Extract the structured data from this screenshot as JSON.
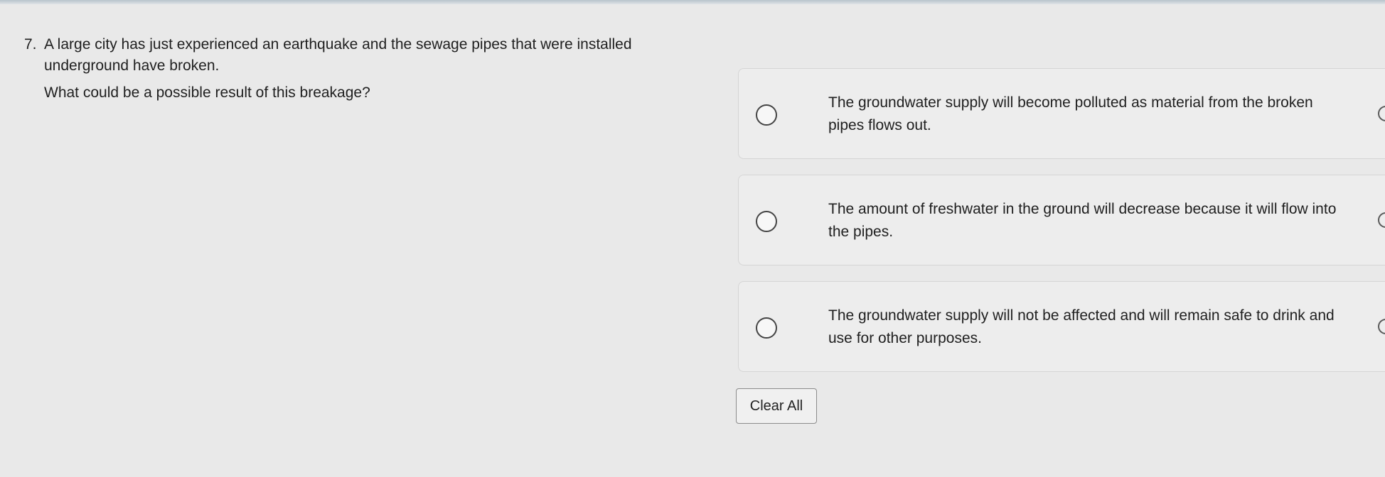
{
  "question": {
    "number": "7.",
    "text": "A large city has just experienced an earthquake and the sewage pipes that were installed underground have broken.",
    "prompt": "What could be a possible result of this breakage?"
  },
  "options": [
    {
      "text": "The groundwater supply will become polluted as material from the broken pipes flows out."
    },
    {
      "text": "The amount of freshwater in the ground will decrease because it will flow into the pipes."
    },
    {
      "text": "The groundwater supply will not be affected and will remain safe to drink and use for other purposes."
    }
  ],
  "actions": {
    "clear_label": "Clear All"
  }
}
